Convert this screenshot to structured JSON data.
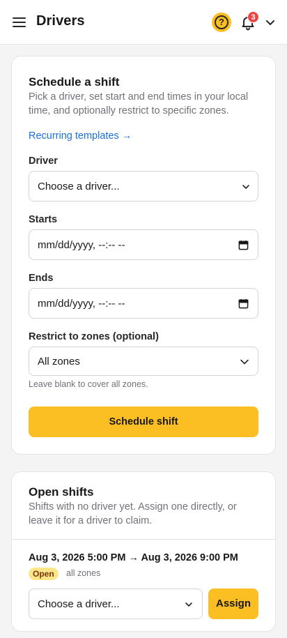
{
  "header": {
    "title": "Drivers",
    "help_glyph": "?",
    "notifications_count": "3",
    "icons": [
      "hamburger-menu-icon",
      "help-icon",
      "bell-icon",
      "chevron-down-icon"
    ]
  },
  "schedule": {
    "title": "Schedule a shift",
    "description": "Pick a driver, set start and end times in your local time, and optionally restrict to specific zones.",
    "templates_link": "Recurring templates →",
    "driver_label": "Driver",
    "driver_value": "Choose a driver...",
    "starts_label": "Starts",
    "starts_value": "mm/dd/yyyy, --:-- --",
    "ends_label": "Ends",
    "ends_value": "mm/dd/yyyy, --:-- --",
    "zones_label": "Restrict to zones (optional)",
    "zones_value": "All zones",
    "zones_hint": "Leave blank to cover all zones.",
    "submit_label": "Schedule shift"
  },
  "open_shifts": {
    "title": "Open shifts",
    "description": "Shifts with no driver yet. Assign one directly, or leave it for a driver to claim.",
    "items": [
      {
        "time_range": "Aug 3, 2026 5:00 PM → Aug 3, 2026 9:00 PM",
        "status": "Open",
        "zones": "all zones",
        "driver_value": "Choose a driver...",
        "assign_label": "Assign"
      }
    ]
  },
  "colors": {
    "accent": "#fbbf24",
    "link": "#1d6fd3",
    "badge": "#ef4444"
  }
}
